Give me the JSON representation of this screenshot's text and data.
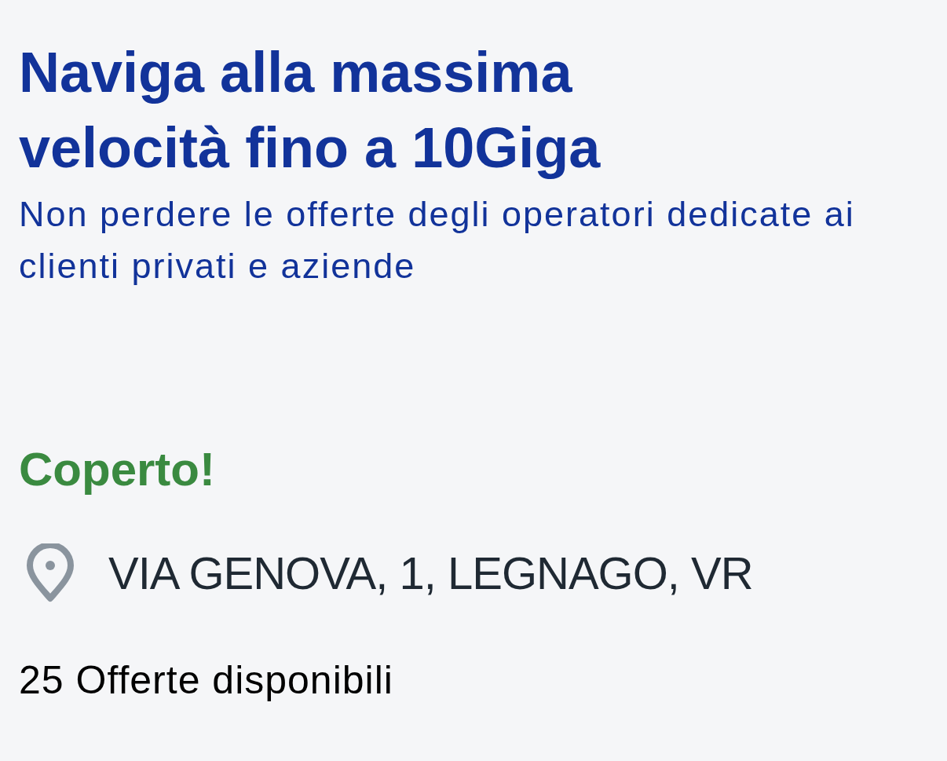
{
  "headline": "Naviga alla massima velocità fino a 10Giga",
  "subtitle": "Non perdere le offerte degli operatori dedicate ai clienti privati e aziende",
  "coverage": {
    "status": "Coperto!",
    "covered": true
  },
  "address": "VIA GENOVA, 1, LEGNAGO, VR",
  "offers_count": "25 Offerte disponibili"
}
